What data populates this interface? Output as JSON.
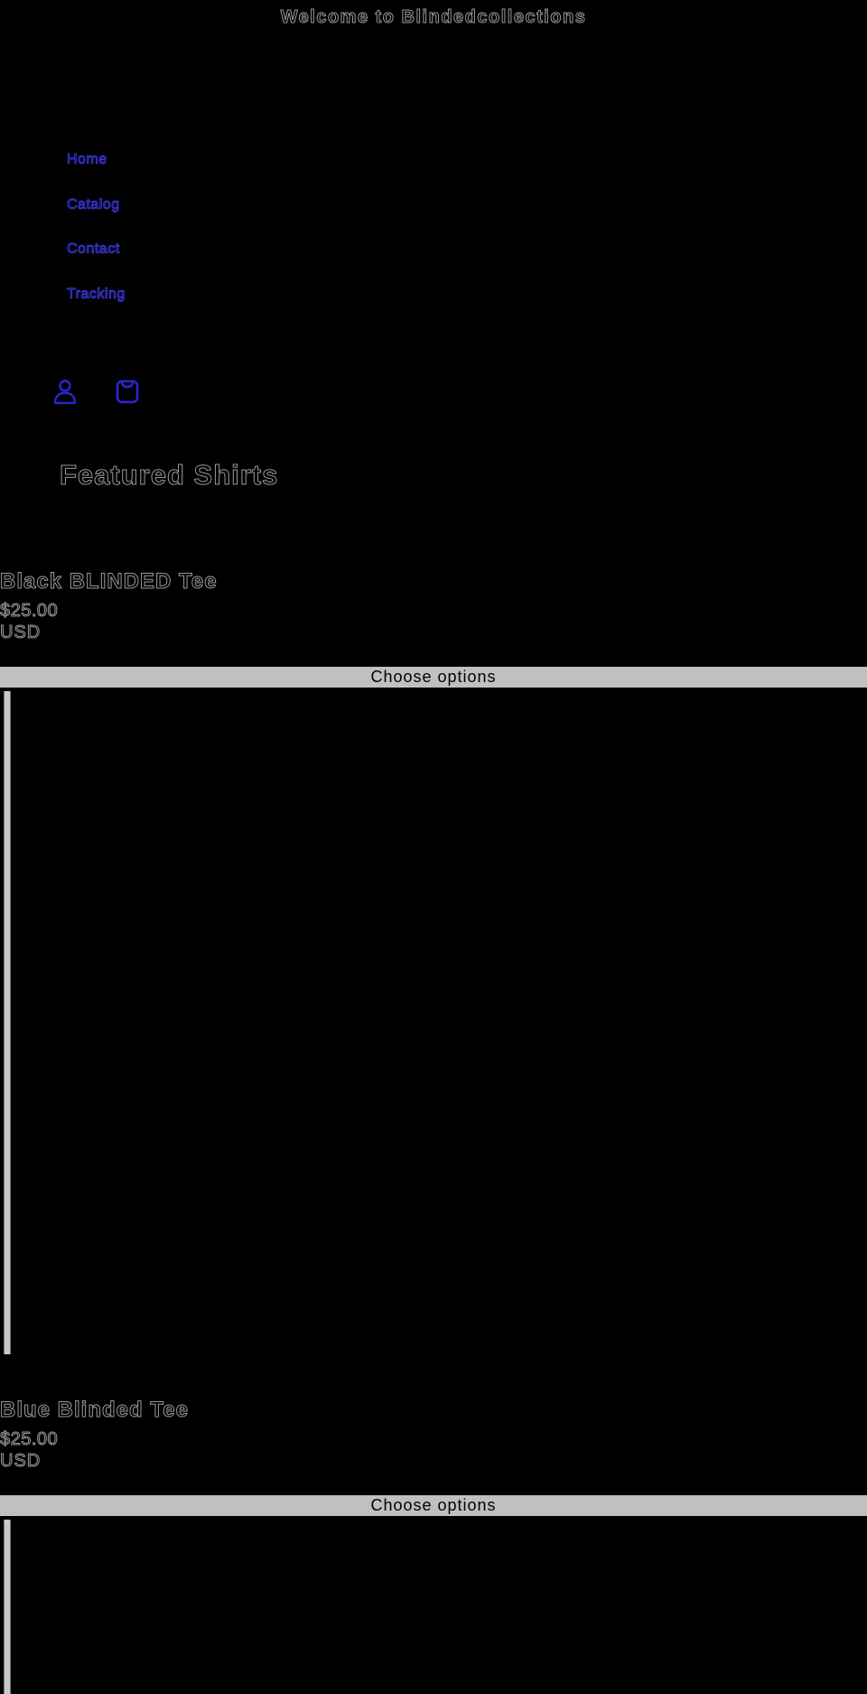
{
  "announcement": "Welcome to Blindedcollections",
  "nav": {
    "items": [
      "Home",
      "Catalog",
      "Contact",
      "Tracking"
    ]
  },
  "header_icons": {
    "account": "account-icon",
    "cart": "cart-icon"
  },
  "colors": {
    "background": "#000000",
    "nav_link": "#3a35d8",
    "text_outline": "#9a9a9a",
    "button_bg": "#c0c0c0"
  },
  "section": {
    "title": "Featured Shirts"
  },
  "products": [
    {
      "title": "Black BLINDED Tee",
      "price": "$25.00",
      "currency": "USD",
      "button": "Choose options"
    },
    {
      "title": "Blue Blinded Tee",
      "price": "$25.00",
      "currency": "USD",
      "button": "Choose options"
    }
  ]
}
